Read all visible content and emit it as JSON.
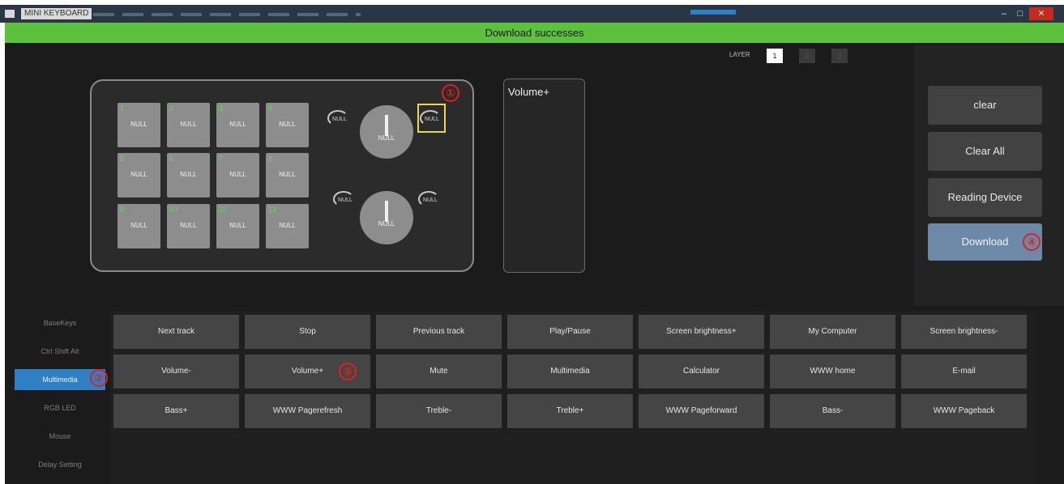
{
  "window": {
    "title": "MINI KEYBOARD",
    "controls": {
      "minimize": "–",
      "maximize": "□",
      "close": "✕"
    }
  },
  "status": {
    "text": "Download successes"
  },
  "layer": {
    "label": "LAYER",
    "buttons": [
      "1",
      "2",
      "3"
    ],
    "selected": "1"
  },
  "device": {
    "keys": [
      {
        "num": "1",
        "value": "NULL"
      },
      {
        "num": "2",
        "value": "NULL"
      },
      {
        "num": "3",
        "value": "NULL"
      },
      {
        "num": "4",
        "value": "NULL"
      },
      {
        "num": "5",
        "value": "NULL"
      },
      {
        "num": "6",
        "value": "NULL"
      },
      {
        "num": "7",
        "value": "NULL"
      },
      {
        "num": "8",
        "value": "NULL"
      },
      {
        "num": "9",
        "value": "NULL"
      },
      {
        "num": "10",
        "value": "NULL"
      },
      {
        "num": "11",
        "value": "NULL"
      },
      {
        "num": "12",
        "value": "NULL"
      }
    ],
    "knobs": [
      {
        "press_value": "NULL",
        "left_value": "NULL",
        "right_value": "NULL"
      },
      {
        "press_value": "NULL",
        "left_value": "NULL",
        "right_value": "NULL"
      }
    ]
  },
  "preview": {
    "text": "Volume+"
  },
  "actions": {
    "clear": "clear",
    "clear_all": "Clear All",
    "reading_device": "Reading Device",
    "download": "Download"
  },
  "categories": {
    "items": [
      "BaseKeys",
      "Ctrl Shift Alt",
      "Multimedia",
      "RGB LED",
      "Mouse",
      "Delay Setting"
    ],
    "active": "Multimedia"
  },
  "functions": {
    "row1": [
      "Next track",
      "Stop",
      "Previous track",
      "Play/Pause",
      "Screen brightness+",
      "My Computer",
      "Screen brightness-"
    ],
    "row2": [
      "Volume-",
      "Volume+",
      "Mute",
      "Multimedia",
      "Calculator",
      "WWW home",
      "E-mail"
    ],
    "row3": [
      "Bass+",
      "WWW Pagerefresh",
      "Treble-",
      "Treble+",
      "WWW Pageforward",
      "Bass-",
      "WWW Pageback"
    ]
  },
  "annotations": [
    "①",
    "②",
    "③",
    "④"
  ],
  "colors": {
    "status_green": "#5cc13c",
    "key_number_green": "#58e04b",
    "active_category_blue": "#2f7fc5",
    "download_button": "#6c8aa8",
    "selected_outline_yellow": "#e8d84a",
    "annotation_red": "#e02020"
  }
}
